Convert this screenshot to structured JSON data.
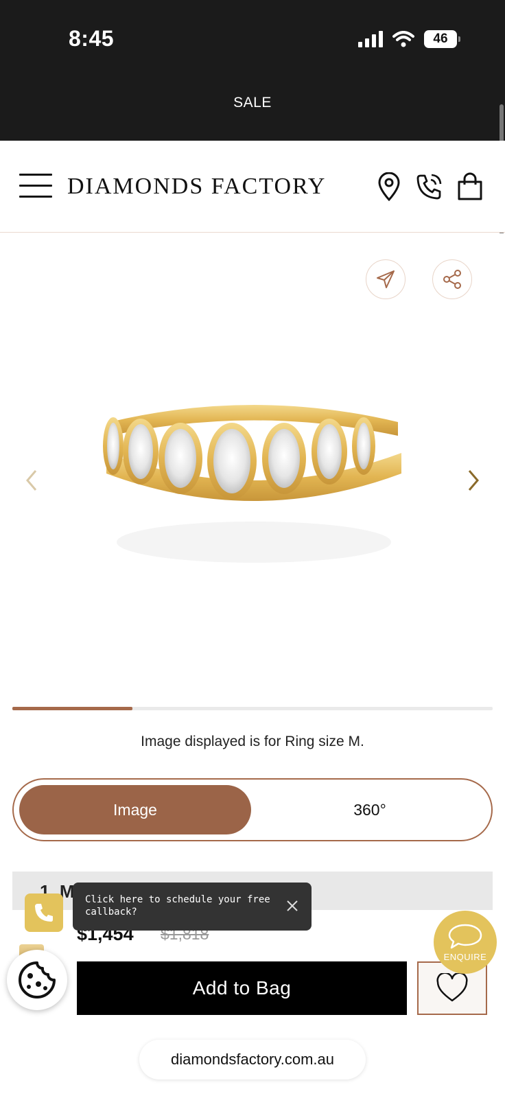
{
  "status_bar": {
    "time": "8:45",
    "battery": "46"
  },
  "banner": {
    "text": "SALE"
  },
  "header": {
    "logo": "DIAMONDS FACTORY"
  },
  "gallery": {
    "progress_fraction": 0.25
  },
  "size_note": "Image displayed is for Ring size M.",
  "view_toggle": {
    "image_label": "Image",
    "rotate_label": "360°"
  },
  "metal_row": {
    "label": "1. Metal: Yellow Gold"
  },
  "callback_tooltip": {
    "text": "Click here to schedule your free callback?"
  },
  "purchase": {
    "price": "$1,454",
    "old_price": "$1,818",
    "add_to_bag": "Add to Bag"
  },
  "enquire": {
    "label": "ENQUIRE"
  },
  "browser": {
    "url": "diamondsfactory.com.au"
  },
  "colors": {
    "accent": "#a5694a",
    "gold": "#e3c35c",
    "dark": "#1b1b1b"
  }
}
